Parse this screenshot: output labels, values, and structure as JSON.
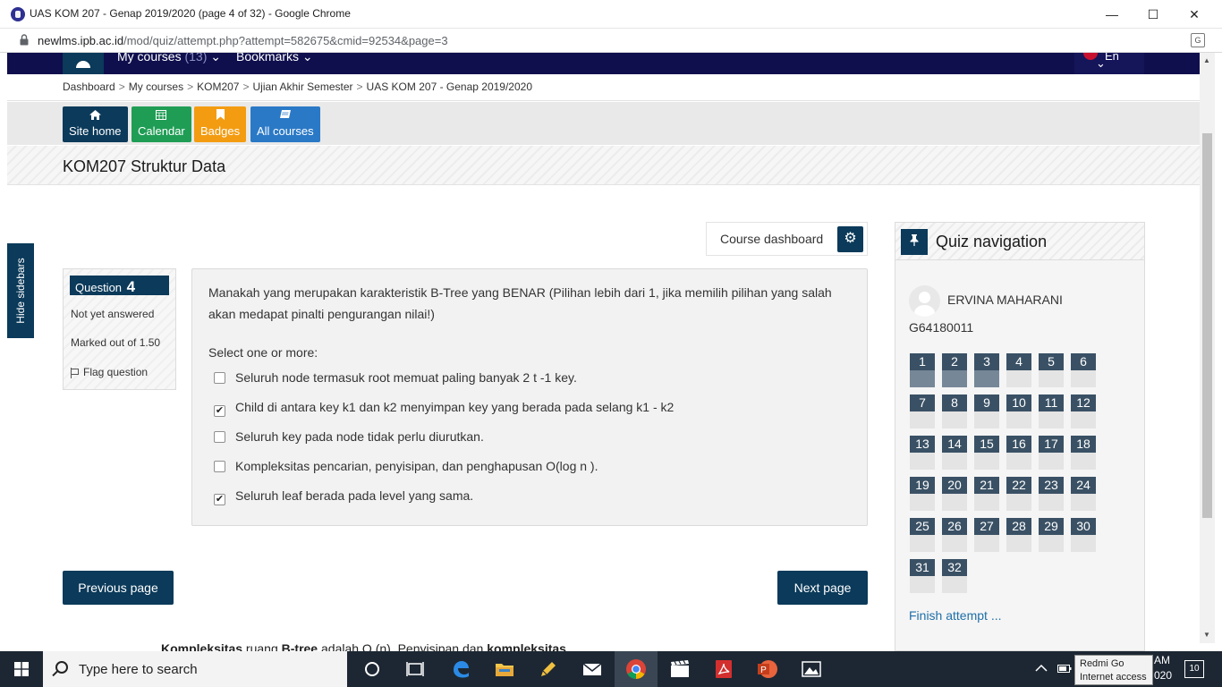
{
  "window": {
    "title": "UAS KOM 207 - Genap 2019/2020 (page 4 of 32) - Google Chrome",
    "minimize_icon": "—",
    "maximize_icon": "☐",
    "close_icon": "✕"
  },
  "address_bar": {
    "host": "newlms.ipb.ac.id",
    "path": "/mod/quiz/attempt.php?attempt=582675&cmid=92534&page=3"
  },
  "navbar": {
    "my_courses": "My courses",
    "my_courses_count": "(13)",
    "bookmarks": "Bookmarks",
    "language": "En"
  },
  "breadcrumb": [
    "Dashboard",
    "My courses",
    "KOM207",
    "Ujian Akhir Semester",
    "UAS KOM 207 - Genap 2019/2020"
  ],
  "quick_links": [
    {
      "label": "Site home",
      "color": "#0b3a5a",
      "icon": "home-icon"
    },
    {
      "label": "Calendar",
      "color": "#1f9d55",
      "icon": "calendar-icon"
    },
    {
      "label": "Badges",
      "color": "#f39c12",
      "icon": "bookmark-icon"
    },
    {
      "label": "All courses",
      "color": "#2a79c6",
      "icon": "book-icon"
    }
  ],
  "course_name": "KOM207 Struktur Data",
  "hide_sidebars": "Hide sidebars",
  "course_dashboard": "Course dashboard",
  "question": {
    "label": "Question",
    "number": "4",
    "state": "Not yet answered",
    "grade": "Marked out of 1.50",
    "flag": "Flag question",
    "text": "Manakah yang merupakan karakteristik B-Tree yang BENAR (Pilihan lebih dari 1, jika memilih pilihan yang salah akan medapat pinalti pengurangan nilai!)",
    "prompt": "Select one or more:",
    "options": [
      {
        "text": "Seluruh node termasuk root memuat paling banyak 2 t -1 key.",
        "checked": false
      },
      {
        "text": "Child di antara key k1 dan k2 menyimpan key yang berada pada selang k1 - k2",
        "checked": true
      },
      {
        "text": "Seluruh key pada node tidak perlu diurutkan.",
        "checked": false
      },
      {
        "text": "Kompleksitas pencarian, penyisipan, dan penghapusan O(log n ).",
        "checked": false
      },
      {
        "text": "Seluruh leaf berada pada level yang sama.",
        "checked": true
      }
    ]
  },
  "buttons": {
    "previous": "Previous page",
    "next": "Next page"
  },
  "quiz_nav": {
    "title": "Quiz navigation",
    "user_name": "ERVINA MAHARANI",
    "user_id": "G64180011",
    "questions": [
      "1",
      "2",
      "3",
      "4",
      "5",
      "6",
      "7",
      "8",
      "9",
      "10",
      "11",
      "12",
      "13",
      "14",
      "15",
      "16",
      "17",
      "18",
      "19",
      "20",
      "21",
      "22",
      "23",
      "24",
      "25",
      "26",
      "27",
      "28",
      "29",
      "30",
      "31",
      "32"
    ],
    "answered": [
      "1",
      "2",
      "3"
    ],
    "finish": "Finish attempt ..."
  },
  "below_text": {
    "b1": "Kompleksitas",
    "t1": " ruang ",
    "b2": "B-tree",
    "t2": " adalah O (n). Penyisipan dan ",
    "b3": "kompleksitas"
  },
  "taskbar": {
    "search_placeholder": "Type here to search",
    "tooltip_line1": "Redmi Go",
    "tooltip_line2": "Internet access",
    "clock_line1": "AM",
    "clock_line2": "020",
    "notifications": "10"
  }
}
